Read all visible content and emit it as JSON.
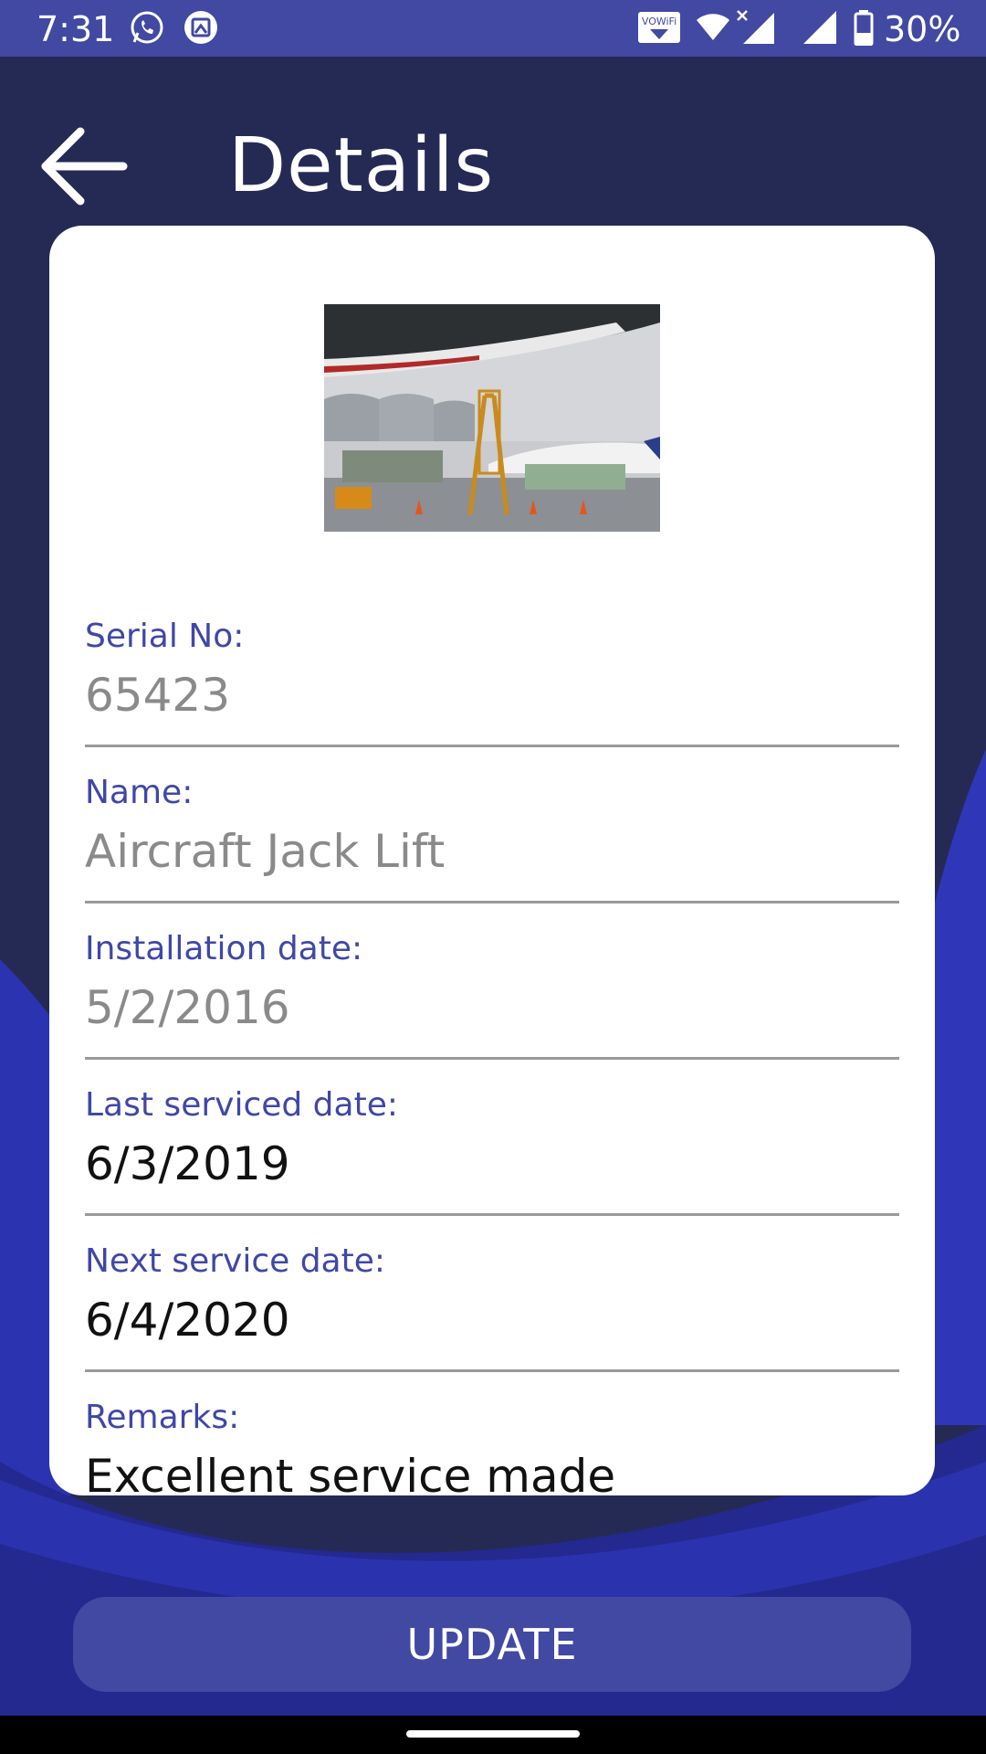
{
  "status_bar": {
    "time": "7:31",
    "vowifi_label": "VOWiFi",
    "battery_percent": "30%",
    "icons": [
      "whatsapp-icon",
      "image-notification-icon",
      "vowifi-icon",
      "wifi-icon",
      "signal-x-icon",
      "signal-icon",
      "battery-icon"
    ]
  },
  "app_bar": {
    "back_icon": "arrow-left-icon",
    "title": "Details"
  },
  "details": {
    "serial": {
      "label": "Serial No:",
      "value": "65423"
    },
    "name": {
      "label": "Name:",
      "value": "Aircraft Jack Lift"
    },
    "installation": {
      "label": "Installation date:",
      "value": "5/2/2016"
    },
    "last_serviced": {
      "label": "Last serviced date:",
      "value": "6/3/2019"
    },
    "next_service": {
      "label": "Next service date:",
      "value": "6/4/2020"
    },
    "remarks": {
      "label": "Remarks:",
      "value": "Excellent service made"
    }
  },
  "update_button": {
    "label": "UPDATE"
  },
  "colors": {
    "accent": "#4149a3",
    "background": "#252a55",
    "label": "#3f47a8",
    "muted_value": "#8a8a8a"
  }
}
